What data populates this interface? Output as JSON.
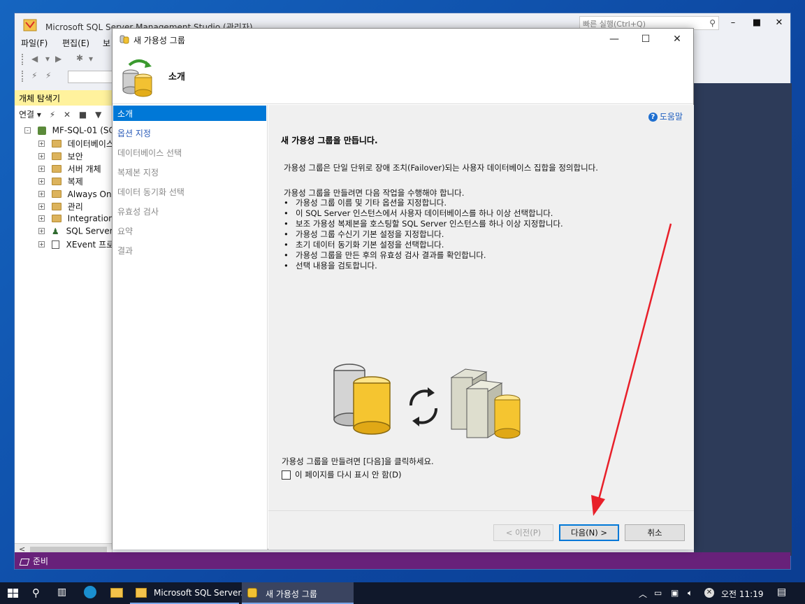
{
  "ssms": {
    "title": "Microsoft SQL Server Management Studio (관리자)",
    "quick_launch_placeholder": "빠른 실행(Ctrl+Q)",
    "menu": [
      "파일(F)",
      "편집(E)",
      "보"
    ],
    "status": "준비"
  },
  "object_explorer": {
    "header": "개체 탐색기",
    "connect": "연결",
    "tree": [
      {
        "label": "MF-SQL-01 (SQ",
        "kind": "server",
        "expander": "-"
      },
      {
        "label": "데이터베이스",
        "kind": "folder",
        "expander": "+"
      },
      {
        "label": "보안",
        "kind": "folder",
        "expander": "+"
      },
      {
        "label": "서버 개체",
        "kind": "folder",
        "expander": "+"
      },
      {
        "label": "복제",
        "kind": "folder",
        "expander": "+"
      },
      {
        "label": "Always On 고",
        "kind": "folder",
        "expander": "+"
      },
      {
        "label": "관리",
        "kind": "folder",
        "expander": "+"
      },
      {
        "label": "Integration S",
        "kind": "folder",
        "expander": "+"
      },
      {
        "label": "SQL Server 0",
        "kind": "agent",
        "expander": "+"
      },
      {
        "label": "XEvent 프로",
        "kind": "xevent",
        "expander": "+"
      }
    ]
  },
  "dialog": {
    "title": "새 가용성 그룹",
    "header_title": "소개",
    "nav": [
      {
        "label": "소개",
        "state": "selected"
      },
      {
        "label": "옵션 지정",
        "state": "link"
      },
      {
        "label": "데이터베이스 선택",
        "state": "disabled"
      },
      {
        "label": "복제본 지정",
        "state": "disabled"
      },
      {
        "label": "데이터 동기화 선택",
        "state": "disabled"
      },
      {
        "label": "유효성 검사",
        "state": "disabled"
      },
      {
        "label": "요약",
        "state": "disabled"
      },
      {
        "label": "결과",
        "state": "disabled"
      }
    ],
    "help": "도움말",
    "heading": "새 가용성 그룹을 만듭니다.",
    "description": "가용성 그룹은 단일 단위로 장애 조치(Failover)되는 사용자 데이터베이스 집합을 정의합니다.",
    "steps_intro": "가용성 그룹을 만들려면 다음 작업을 수행해야 합니다.",
    "steps": [
      "가용성 그룹 이름 및 기타 옵션을 지정합니다.",
      "이 SQL Server 인스턴스에서 사용자 데이터베이스를 하나 이상 선택합니다.",
      "보조 가용성 복제본을 호스팅할 SQL Server 인스턴스를 하나 이상 지정합니다.",
      "가용성 그룹 수신기 기본 설정을 지정합니다.",
      "초기 데이터 동기화 기본 설정을 선택합니다.",
      "가용성 그룹을 만든 후의 유효성 검사 결과를 확인합니다.",
      "선택 내용을 검토합니다."
    ],
    "click_next": "가용성 그룹을 만들려면 [다음]을 클릭하세요.",
    "dont_show": "이 페이지를 다시 표시 안 함(D)",
    "dont_show_checked": false,
    "buttons": {
      "prev": "< 이전(P)",
      "next": "다음(N) >",
      "cancel": "취소"
    }
  },
  "taskbar": {
    "apps": [
      {
        "label": "Microsoft SQL Server...",
        "active": false
      },
      {
        "label": "새 가용성 그룹",
        "active": true
      }
    ],
    "time": "오전 11:19"
  },
  "colors": {
    "accent": "#0078d7",
    "status_bar": "#68217a",
    "oe_header": "#fff29d",
    "annotation_arrow": "#e8202a"
  }
}
